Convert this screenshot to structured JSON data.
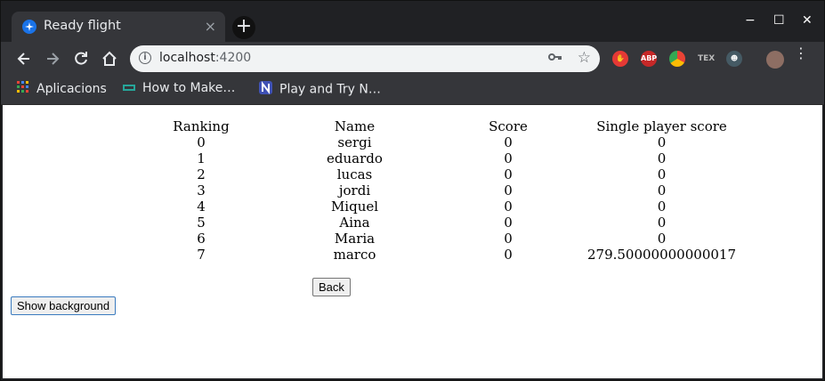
{
  "browser": {
    "tab_title": "Ready flight",
    "tab_close": "×",
    "new_tab": "+",
    "window_controls": {
      "minimize": "−",
      "maximize": "☐",
      "close": "✕"
    },
    "url_host": "localhost",
    "url_port": ":4200",
    "icons": [
      "back-icon",
      "forward-icon",
      "reload-icon",
      "home-icon",
      "info-icon",
      "key-icon",
      "star-icon"
    ],
    "extensions": [
      {
        "name": "stop-extension-icon",
        "label": "",
        "color": "#e53935"
      },
      {
        "name": "adblock-extension-icon",
        "label": "ABP",
        "color": "#c62828"
      },
      {
        "name": "chrome-extension-icon",
        "label": "",
        "color": "#fbbc05"
      },
      {
        "name": "tex-extension-icon",
        "label": "TEX",
        "color": "#35363a"
      },
      {
        "name": "spy-extension-icon",
        "label": "",
        "color": "#455a64"
      },
      {
        "name": "profile-avatar",
        "label": "",
        "color": "#8d6e63"
      }
    ],
    "bookmarks": [
      {
        "label": "Aplicacions",
        "icon": "apps-grid-icon"
      },
      {
        "label": "How to Make…",
        "icon": "bookmark-site-icon"
      },
      {
        "label": "Play and Try N…",
        "icon": "n-logo-icon"
      }
    ]
  },
  "ranking_table": {
    "headers": [
      "Ranking",
      "Name",
      "Score",
      "Single player score"
    ],
    "rows": [
      [
        "0",
        "sergi",
        "0",
        "0"
      ],
      [
        "1",
        "eduardo",
        "0",
        "0"
      ],
      [
        "2",
        "lucas",
        "0",
        "0"
      ],
      [
        "3",
        "jordi",
        "0",
        "0"
      ],
      [
        "4",
        "Miquel",
        "0",
        "0"
      ],
      [
        "5",
        "Aina",
        "0",
        "0"
      ],
      [
        "6",
        "Maria",
        "0",
        "0"
      ],
      [
        "7",
        "marco",
        "0",
        "279.50000000000017"
      ]
    ]
  },
  "buttons": {
    "back_label": "Back",
    "show_background_label": "Show background"
  }
}
